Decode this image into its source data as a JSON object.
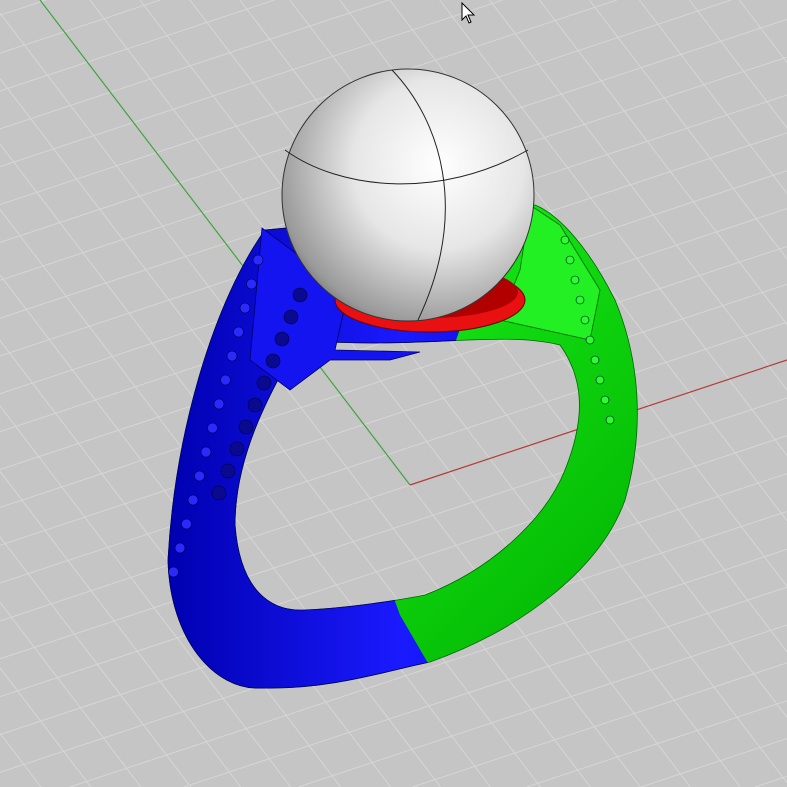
{
  "viewport": {
    "background": "#c5c5c5",
    "grid_line_color": "#d6d6d6",
    "x_axis_color": "#b23a3a",
    "y_axis_color": "#3fa33f"
  },
  "model": {
    "left_shank_color": "#1010e0",
    "right_shank_color": "#10e010",
    "bezel_color": "#e01010",
    "pearl_color": "#e8e8e8"
  }
}
